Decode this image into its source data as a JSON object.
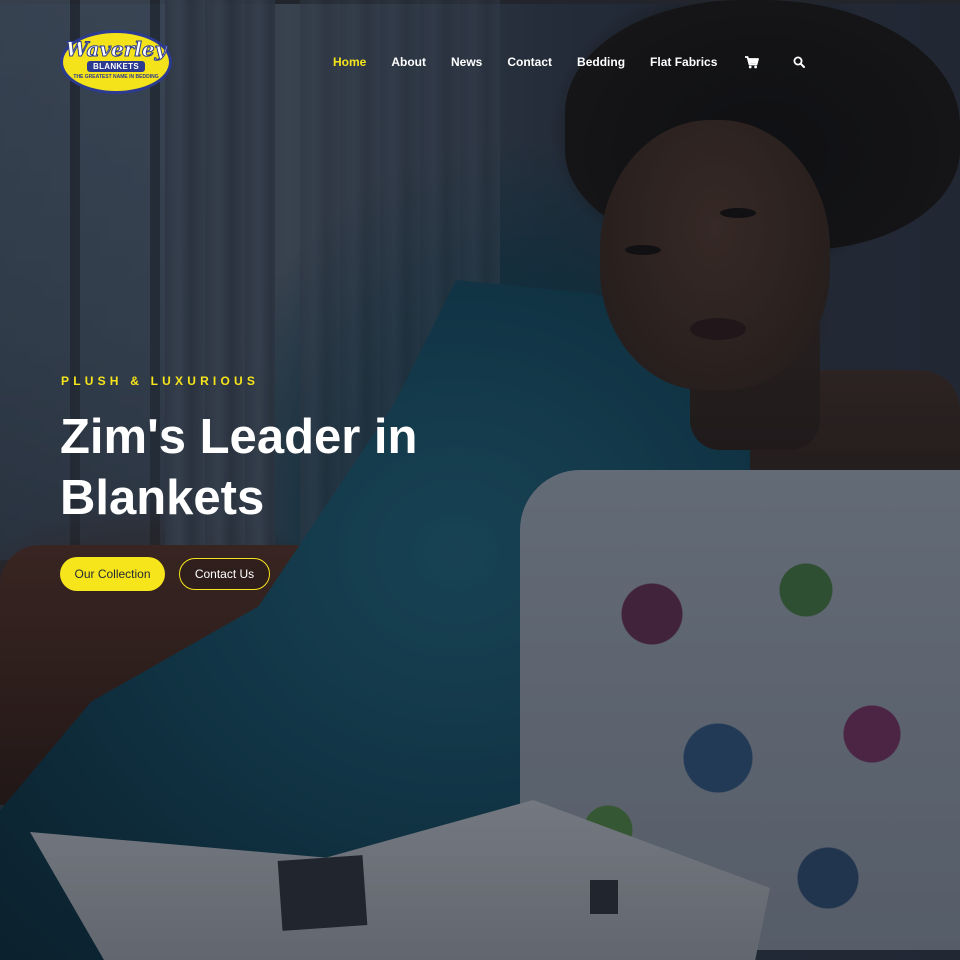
{
  "brand": {
    "logo_script": "Waverley",
    "logo_band": "BLANKETS",
    "logo_tagline": "THE GREATEST NAME IN BEDDING"
  },
  "nav": {
    "items": [
      {
        "label": "Home",
        "active": true
      },
      {
        "label": "About",
        "active": false
      },
      {
        "label": "News",
        "active": false
      },
      {
        "label": "Contact",
        "active": false
      },
      {
        "label": "Bedding",
        "active": false
      },
      {
        "label": "Flat Fabrics",
        "active": false
      }
    ],
    "icons": [
      "cart-icon",
      "search-icon"
    ]
  },
  "hero": {
    "eyebrow": "PLUSH & LUXURIOUS",
    "headline": "Zim's Leader in Blankets",
    "primary_button": "Our Collection",
    "secondary_button": "Contact Us"
  },
  "colors": {
    "accent": "#f7e51c",
    "text": "#ffffff",
    "logo_blue": "#2c3a8f"
  }
}
